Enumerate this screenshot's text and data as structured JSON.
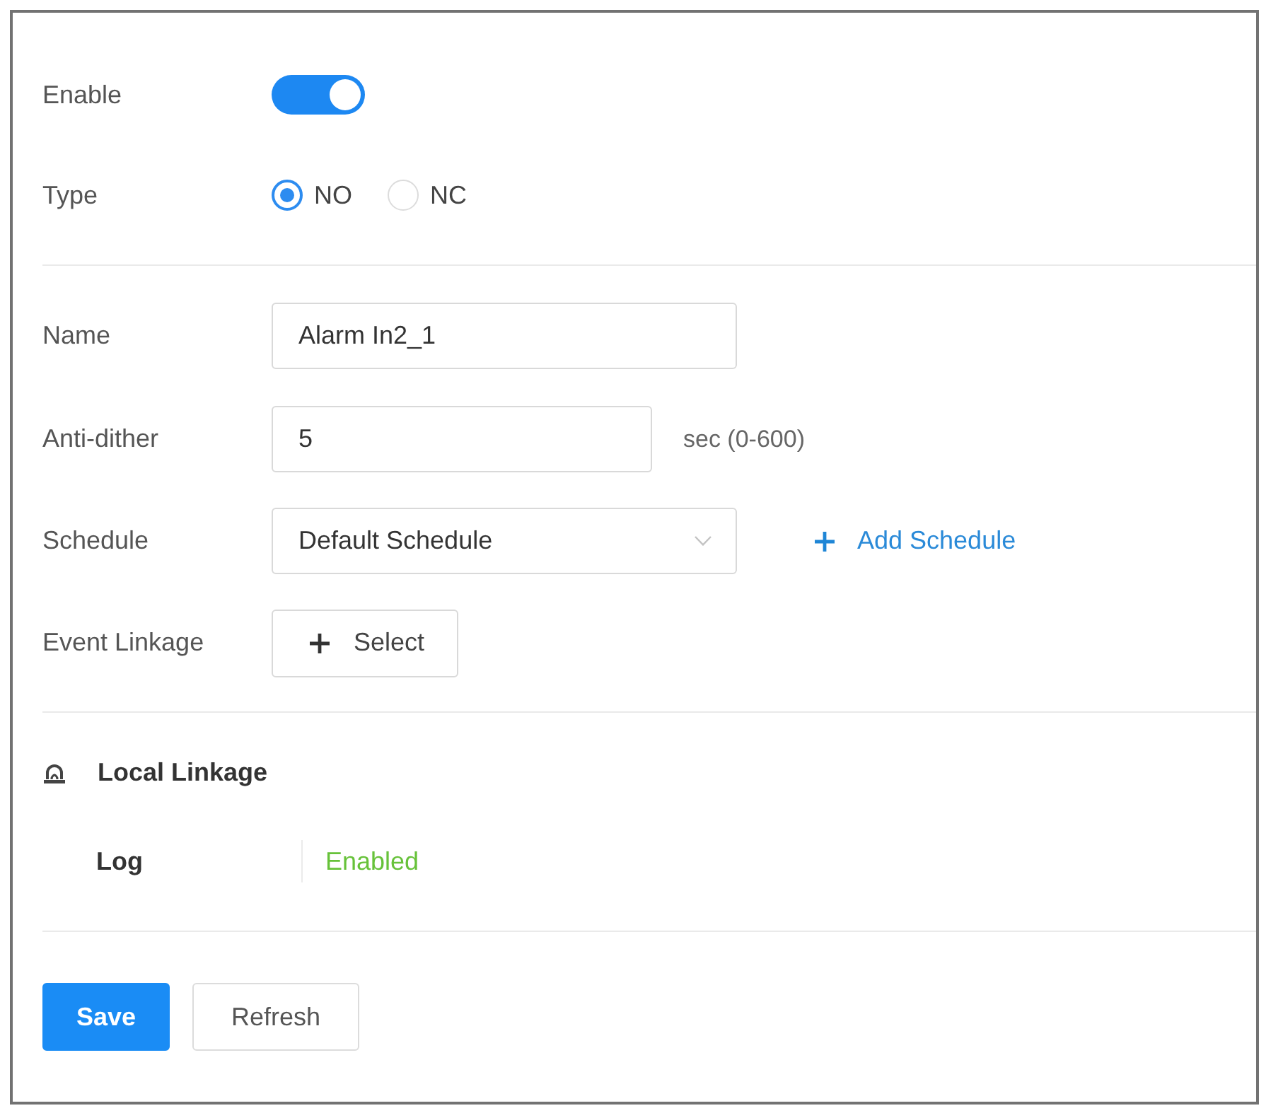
{
  "enable": {
    "label": "Enable",
    "on": true
  },
  "type": {
    "label": "Type",
    "options": [
      {
        "label": "NO",
        "selected": true
      },
      {
        "label": "NC",
        "selected": false
      }
    ]
  },
  "fields": [
    {
      "kind": "input",
      "label": "Name",
      "value": "Alarm In2_1"
    },
    {
      "kind": "input",
      "label": "Anti-dither",
      "value": "5",
      "hint": "sec (0-600)"
    },
    {
      "kind": "dropdown",
      "label": "Schedule",
      "value": "Default Schedule",
      "action": "Add Schedule"
    },
    {
      "kind": "button",
      "label": "Event Linkage",
      "button": "Select"
    }
  ],
  "local_linkage": {
    "title": "Local Linkage",
    "items": [
      {
        "label": "Log",
        "value": "Enabled"
      }
    ]
  },
  "buttons": [
    {
      "label": "Save",
      "kind": "primary"
    },
    {
      "label": "Refresh",
      "kind": "default"
    }
  ]
}
